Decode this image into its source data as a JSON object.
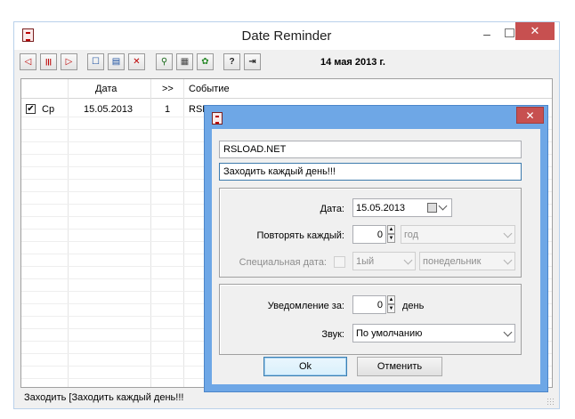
{
  "window": {
    "title": "Date Reminder",
    "minimize_glyph": "–",
    "close_glyph": "✕"
  },
  "toolbar": {
    "current_date": "14 мая 2013 г.",
    "buttons": [
      {
        "icon": "prev-arrow-icon",
        "glyph": "◁"
      },
      {
        "icon": "bars-icon",
        "glyph": "|||"
      },
      {
        "icon": "next-arrow-icon",
        "glyph": "▷"
      },
      {
        "icon": "new-icon",
        "glyph": "☐"
      },
      {
        "icon": "edit-icon",
        "glyph": "▤"
      },
      {
        "icon": "delete-icon",
        "glyph": "✕"
      },
      {
        "icon": "search-icon",
        "glyph": "⚲"
      },
      {
        "icon": "calendar-icon",
        "glyph": "▦"
      },
      {
        "icon": "gear-icon",
        "glyph": "✿"
      },
      {
        "icon": "help-icon",
        "glyph": "?"
      },
      {
        "icon": "exit-icon",
        "glyph": "⇥"
      }
    ]
  },
  "grid": {
    "columns": [
      "Дата",
      ">>",
      "Событие"
    ],
    "rows": [
      {
        "checked": "✔",
        "day": "Ср",
        "date": "15.05.2013",
        "count": "1",
        "event": "RSLOAD.NET"
      }
    ]
  },
  "status": {
    "text": "Заходить [Заходить каждый день!!!"
  },
  "dialog": {
    "close_glyph": "✕",
    "title_value": "RSLOAD.NET",
    "note_value": "Заходить каждый день!!!",
    "date_label": "Дата:",
    "date_value": "15.05.2013",
    "repeat_label": "Повторять каждый:",
    "repeat_value": "0",
    "repeat_unit": "год",
    "special_label": "Специальная дата:",
    "special_ordinal": "1ый",
    "special_weekday": "понедельник",
    "notify_label": "Уведомление за:",
    "notify_value": "0",
    "notify_unit": "день",
    "sound_label": "Звук:",
    "sound_value": "По умолчанию",
    "ok_label": "Ok",
    "cancel_label": "Отменить"
  },
  "colors": {
    "dialog_frame": "#6ea7e6",
    "close_button": "#c75050"
  }
}
